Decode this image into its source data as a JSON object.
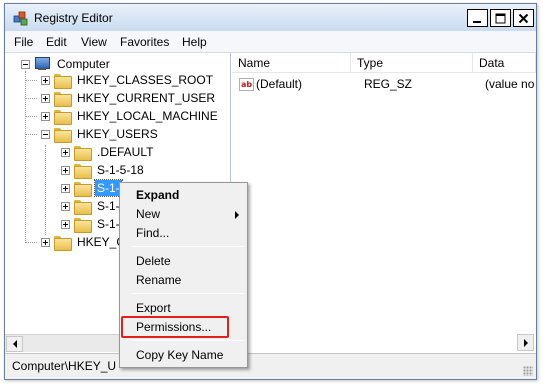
{
  "window": {
    "title": "Registry Editor",
    "caption_buttons": {
      "minimize": "_",
      "maximize": "□",
      "close": "✕"
    }
  },
  "menubar": [
    "File",
    "Edit",
    "View",
    "Favorites",
    "Help"
  ],
  "tree": {
    "root": "Computer",
    "hives": [
      "HKEY_CLASSES_ROOT",
      "HKEY_CURRENT_USER",
      "HKEY_LOCAL_MACHINE",
      "HKEY_USERS"
    ],
    "users_children": [
      ".DEFAULT",
      "S-1-5-18",
      "S-1-",
      "S-1-",
      "S-1-"
    ],
    "last_hive": "HKEY_C"
  },
  "list": {
    "columns": [
      "Name",
      "Type",
      "Data"
    ],
    "rows": [
      {
        "name": "(Default)",
        "type": "REG_SZ",
        "data": "(value no"
      }
    ]
  },
  "status": {
    "path": "Computer\\HKEY_U"
  },
  "context_menu": {
    "items": [
      "Expand",
      "New",
      "Find...",
      "Delete",
      "Rename",
      "Export",
      "Permissions...",
      "Copy Key Name"
    ],
    "highlighted": "Permissions...",
    "highlight_color": "#e0201e",
    "icons": [
      "folder-icon",
      "computer-icon",
      "string-value-icon"
    ]
  }
}
